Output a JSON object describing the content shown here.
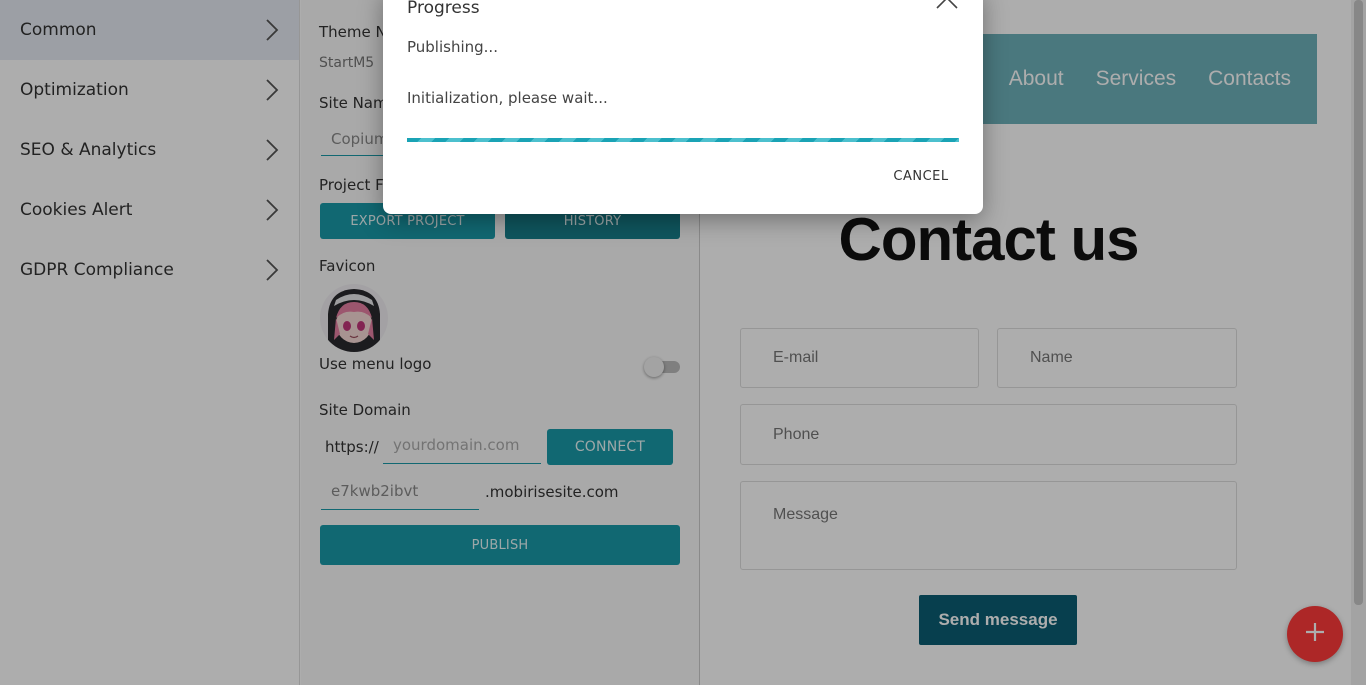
{
  "sidebar": {
    "items": [
      {
        "label": "Common"
      },
      {
        "label": "Optimization"
      },
      {
        "label": "SEO & Analytics"
      },
      {
        "label": "Cookies Alert"
      },
      {
        "label": "GDPR Compliance"
      }
    ]
  },
  "panel": {
    "theme_label": "Theme Na",
    "theme_value": "StartM5",
    "site_name_label": "Site Nam",
    "site_name_value": "Copium",
    "project_files_label": "Project Fi",
    "export_label": "EXPORT PROJECT",
    "history_label": "HISTORY",
    "favicon_label": "Favicon",
    "use_menu_logo_label": "Use menu logo",
    "site_domain_label": "Site Domain",
    "https_prefix": "https://",
    "domain_placeholder": "yourdomain.com",
    "connect_label": "CONNECT",
    "subdomain_value": "e7kwb2ibvt",
    "subdomain_suffix": ".mobirisesite.com",
    "publish_label": "PUBLISH"
  },
  "preview": {
    "nav": [
      "About",
      "Services",
      "Contacts"
    ],
    "title": "Contact us",
    "email_placeholder": "E-mail",
    "name_placeholder": "Name",
    "phone_placeholder": "Phone",
    "message_placeholder": "Message",
    "send_label": "Send message"
  },
  "modal": {
    "title": "Progress",
    "status": "Publishing...",
    "substatus": "Initialization, please wait...",
    "cancel_label": "CANCEL"
  },
  "colors": {
    "accent": "#1a9aa8",
    "navbar": "#6db1ba",
    "send_button": "#0b5e74",
    "fab": "#ff3a3a"
  }
}
